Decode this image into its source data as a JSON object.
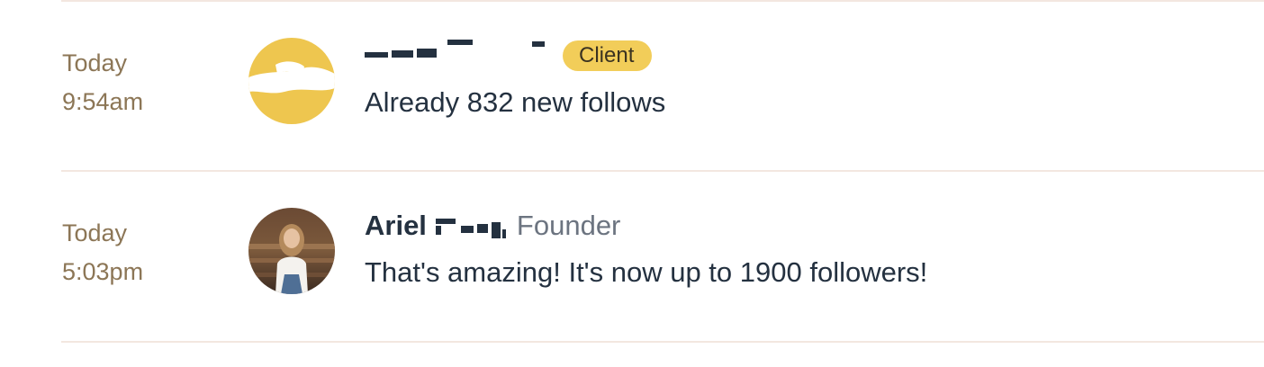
{
  "messages": [
    {
      "date": "Today",
      "time": "9:54am",
      "avatar": "initials-avatar",
      "badge": "Client",
      "text": "Already 832 new follows"
    },
    {
      "date": "Today",
      "time": "5:03pm",
      "avatar": "photo-avatar",
      "name": "Ariel",
      "role": "Founder",
      "text": "That's amazing! It's now up to 1900 followers!"
    }
  ],
  "colors": {
    "time": "#8c7656",
    "text": "#243140",
    "role": "#6c7480",
    "badge_bg": "#f2cd59",
    "avatar_yellow": "#eec64f",
    "divider": "#f3e7e0"
  }
}
